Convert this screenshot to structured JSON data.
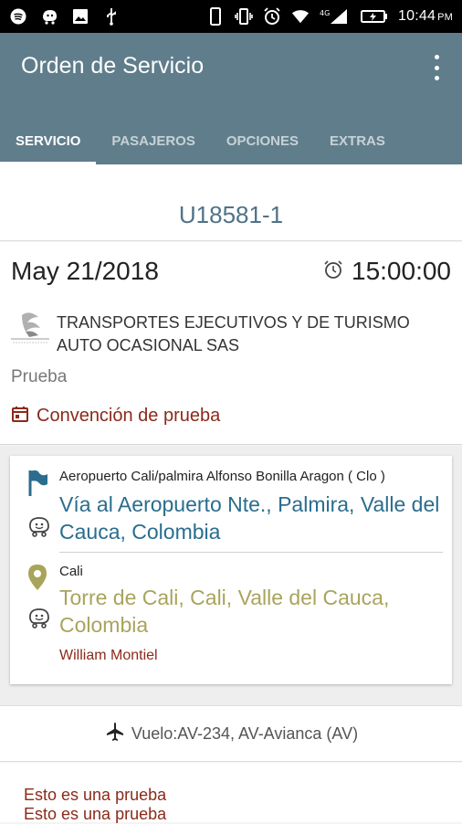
{
  "status_bar": {
    "time": "10:44",
    "ampm": "PM",
    "network": "4G"
  },
  "app": {
    "title": "Orden de Servicio"
  },
  "tabs": [
    {
      "label": "SERVICIO",
      "active": true
    },
    {
      "label": "PASAJEROS",
      "active": false
    },
    {
      "label": "OPCIONES",
      "active": false
    },
    {
      "label": "EXTRAS",
      "active": false
    }
  ],
  "order": {
    "code": "U18581-1",
    "date": "May 21/2018",
    "time": "15:00:00",
    "company": "TRANSPORTES EJECUTIVOS Y DE TURISMO AUTO OCASIONAL SAS",
    "description": "Prueba",
    "convention": "Convención de prueba"
  },
  "route": {
    "origin": {
      "label": "Aeropuerto Cali/palmira Alfonso Bonilla Aragon ( Clo )",
      "address": "Vía al Aeropuerto Nte., Palmira, Valle del Cauca, Colombia"
    },
    "destination": {
      "label": "Cali",
      "address": "Torre de Cali, Cali, Valle del Cauca, Colombia",
      "contact": "William Montiel"
    }
  },
  "flight": "Vuelo:AV-234, AV-Avianca (AV)",
  "notes": [
    "Esto es una prueba",
    "Esto es una prueba"
  ],
  "colors": {
    "appbar": "#607d8b",
    "accent_red": "#8b2a1a",
    "origin_blue": "#2a6d8e",
    "dest_olive": "#a9a45b"
  }
}
